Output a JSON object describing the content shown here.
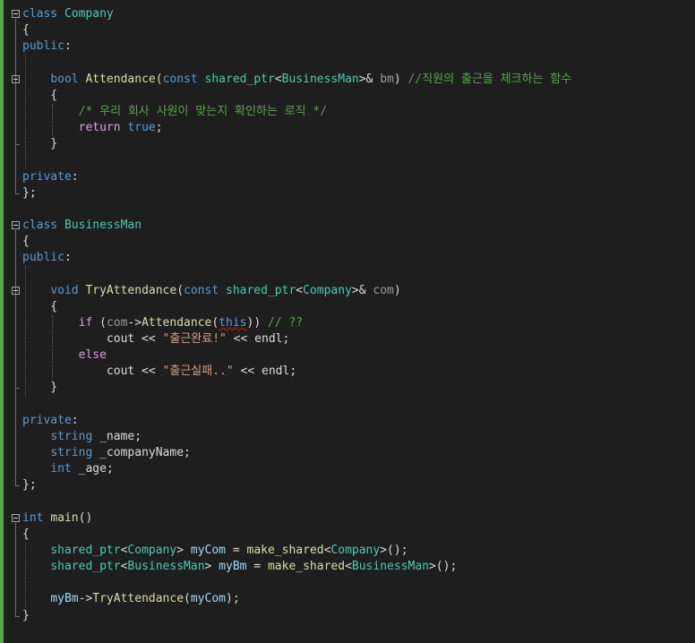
{
  "editor": {
    "language": "C++",
    "lines": [
      [
        {
          "t": "class",
          "c": "kw"
        },
        {
          "t": " "
        },
        {
          "t": "Company",
          "c": "cls"
        }
      ],
      [
        {
          "t": "{"
        }
      ],
      [
        {
          "t": "public",
          "c": "kw"
        },
        {
          "t": ":"
        }
      ],
      [],
      [
        {
          "t": "    "
        },
        {
          "t": "bool",
          "c": "kw"
        },
        {
          "t": " "
        },
        {
          "t": "Attendance",
          "c": "fn"
        },
        {
          "t": "("
        },
        {
          "t": "const",
          "c": "kw"
        },
        {
          "t": " "
        },
        {
          "t": "shared_ptr",
          "c": "cls"
        },
        {
          "t": "<"
        },
        {
          "t": "BusinessMan",
          "c": "cls"
        },
        {
          "t": ">& "
        },
        {
          "t": "bm",
          "c": "prm"
        },
        {
          "t": ") "
        },
        {
          "t": "//직원의 출근을 체크하는 함수",
          "c": "cmt"
        }
      ],
      [
        {
          "t": "    {"
        }
      ],
      [
        {
          "t": "        "
        },
        {
          "t": "/* 우리 회사 사원이 맞는지 확인하는 로직 */",
          "c": "cmt"
        }
      ],
      [
        {
          "t": "        "
        },
        {
          "t": "return",
          "c": "ctl"
        },
        {
          "t": " "
        },
        {
          "t": "true",
          "c": "kw"
        },
        {
          "t": ";"
        }
      ],
      [
        {
          "t": "    }"
        }
      ],
      [],
      [
        {
          "t": "private",
          "c": "kw"
        },
        {
          "t": ":"
        }
      ],
      [
        {
          "t": "};"
        }
      ],
      [],
      [
        {
          "t": "class",
          "c": "kw"
        },
        {
          "t": " "
        },
        {
          "t": "BusinessMan",
          "c": "cls"
        }
      ],
      [
        {
          "t": "{"
        }
      ],
      [
        {
          "t": "public",
          "c": "kw"
        },
        {
          "t": ":"
        }
      ],
      [],
      [
        {
          "t": "    "
        },
        {
          "t": "void",
          "c": "kw"
        },
        {
          "t": " "
        },
        {
          "t": "TryAttendance",
          "c": "fn"
        },
        {
          "t": "("
        },
        {
          "t": "const",
          "c": "kw"
        },
        {
          "t": " "
        },
        {
          "t": "shared_ptr",
          "c": "cls"
        },
        {
          "t": "<"
        },
        {
          "t": "Company",
          "c": "cls"
        },
        {
          "t": ">& "
        },
        {
          "t": "com",
          "c": "prm"
        },
        {
          "t": ")"
        }
      ],
      [
        {
          "t": "    {"
        }
      ],
      [
        {
          "t": "        "
        },
        {
          "t": "if",
          "c": "ctl"
        },
        {
          "t": " ("
        },
        {
          "t": "com",
          "c": "prm"
        },
        {
          "t": "->"
        },
        {
          "t": "Attendance",
          "c": "fn"
        },
        {
          "t": "("
        },
        {
          "t": "this",
          "c": "kw squig"
        },
        {
          "t": ")) "
        },
        {
          "t": "// ??",
          "c": "cmt"
        }
      ],
      [
        {
          "t": "            cout << "
        },
        {
          "t": "\"출근완료!\"",
          "c": "str"
        },
        {
          "t": " << endl;"
        }
      ],
      [
        {
          "t": "        "
        },
        {
          "t": "else",
          "c": "ctl"
        }
      ],
      [
        {
          "t": "            cout << "
        },
        {
          "t": "\"출근실패..\"",
          "c": "str"
        },
        {
          "t": " << endl;"
        }
      ],
      [
        {
          "t": "    }"
        }
      ],
      [],
      [
        {
          "t": "private",
          "c": "kw"
        },
        {
          "t": ":"
        }
      ],
      [
        {
          "t": "    "
        },
        {
          "t": "string",
          "c": "kw"
        },
        {
          "t": " _name;"
        }
      ],
      [
        {
          "t": "    "
        },
        {
          "t": "string",
          "c": "kw"
        },
        {
          "t": " _companyName;"
        }
      ],
      [
        {
          "t": "    "
        },
        {
          "t": "int",
          "c": "kw"
        },
        {
          "t": " _age;"
        }
      ],
      [
        {
          "t": "};"
        }
      ],
      [],
      [
        {
          "t": "int",
          "c": "kw"
        },
        {
          "t": " "
        },
        {
          "t": "main",
          "c": "fn"
        },
        {
          "t": "()"
        }
      ],
      [
        {
          "t": "{"
        }
      ],
      [
        {
          "t": "    "
        },
        {
          "t": "shared_ptr",
          "c": "cls"
        },
        {
          "t": "<"
        },
        {
          "t": "Company",
          "c": "cls"
        },
        {
          "t": "> "
        },
        {
          "t": "myCom",
          "c": "var"
        },
        {
          "t": " = "
        },
        {
          "t": "make_shared",
          "c": "fn"
        },
        {
          "t": "<"
        },
        {
          "t": "Company",
          "c": "cls"
        },
        {
          "t": ">();"
        }
      ],
      [
        {
          "t": "    "
        },
        {
          "t": "shared_ptr",
          "c": "cls"
        },
        {
          "t": "<"
        },
        {
          "t": "BusinessMan",
          "c": "cls"
        },
        {
          "t": "> "
        },
        {
          "t": "myBm",
          "c": "var"
        },
        {
          "t": " = "
        },
        {
          "t": "make_shared",
          "c": "fn"
        },
        {
          "t": "<"
        },
        {
          "t": "BusinessMan",
          "c": "cls"
        },
        {
          "t": ">();"
        }
      ],
      [],
      [
        {
          "t": "    "
        },
        {
          "t": "myBm",
          "c": "var"
        },
        {
          "t": "->"
        },
        {
          "t": "TryAttendance",
          "c": "fn"
        },
        {
          "t": "("
        },
        {
          "t": "myCom",
          "c": "var"
        },
        {
          "t": ");"
        }
      ],
      [
        {
          "t": "}"
        }
      ]
    ],
    "fold_lines": [
      0,
      4,
      13,
      17,
      31
    ]
  }
}
